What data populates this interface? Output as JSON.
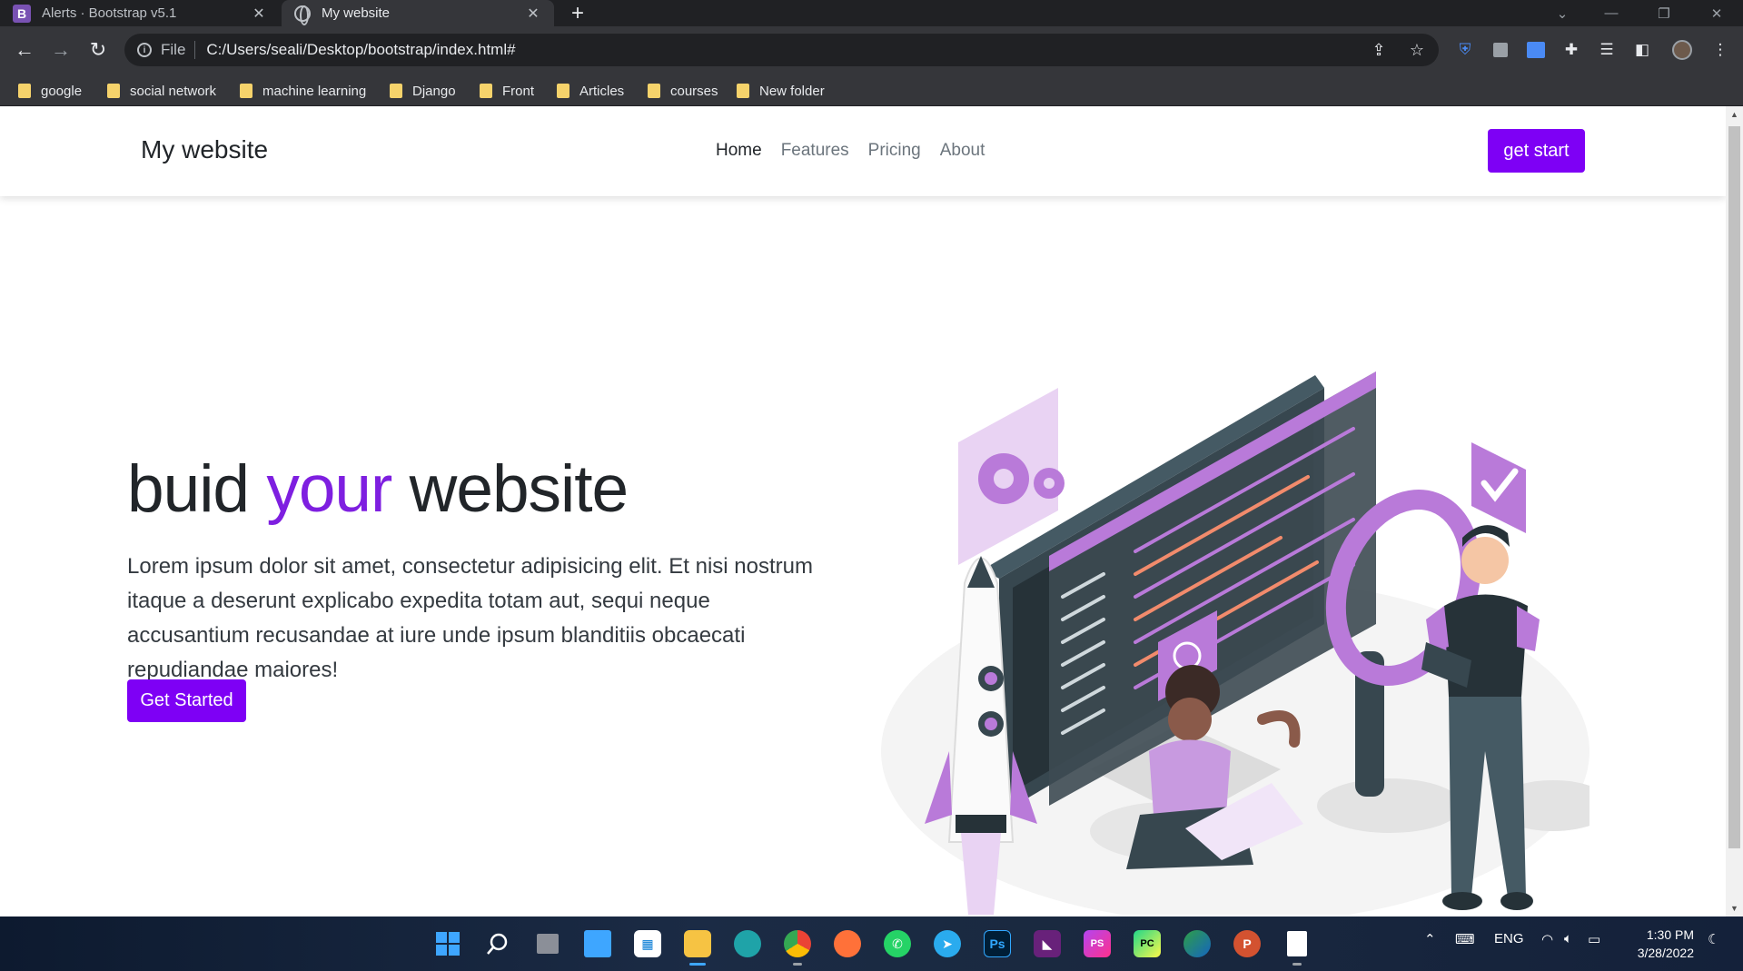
{
  "browser": {
    "tabs": [
      {
        "title": "Alerts · Bootstrap v5.1",
        "active": false
      },
      {
        "title": "My website",
        "active": true
      }
    ],
    "address": {
      "scheme_label": "File",
      "url": "C:/Users/seali/Desktop/bootstrap/index.html#"
    },
    "bookmarks": [
      "google",
      "social network",
      "machine learning",
      "Django",
      "Front",
      "Articles",
      "courses",
      "New folder"
    ]
  },
  "site": {
    "brand": "My website",
    "nav": [
      "Home",
      "Features",
      "Pricing",
      "About"
    ],
    "nav_active": "Home",
    "cta_label": "get start",
    "hero": {
      "title_part1": "buid",
      "title_accent": "your",
      "title_part2": "website",
      "paragraph": "Lorem ipsum dolor sit amet, consectetur adipisicing elit. Et nisi nostrum itaque a deserunt explicabo expedita totam aut, sequi neque accusantium recusandae at iure unde ipsum blanditiis obcaecati repudiandae maiores!",
      "button_label": "Get Started"
    }
  },
  "taskbar": {
    "tray_language": "ENG",
    "time": "1:30 PM",
    "date": "3/28/2022"
  },
  "colors": {
    "accent": "#7e00f5",
    "accent_text": "#7e1fe0",
    "illustration_purple": "#b97ad9"
  }
}
